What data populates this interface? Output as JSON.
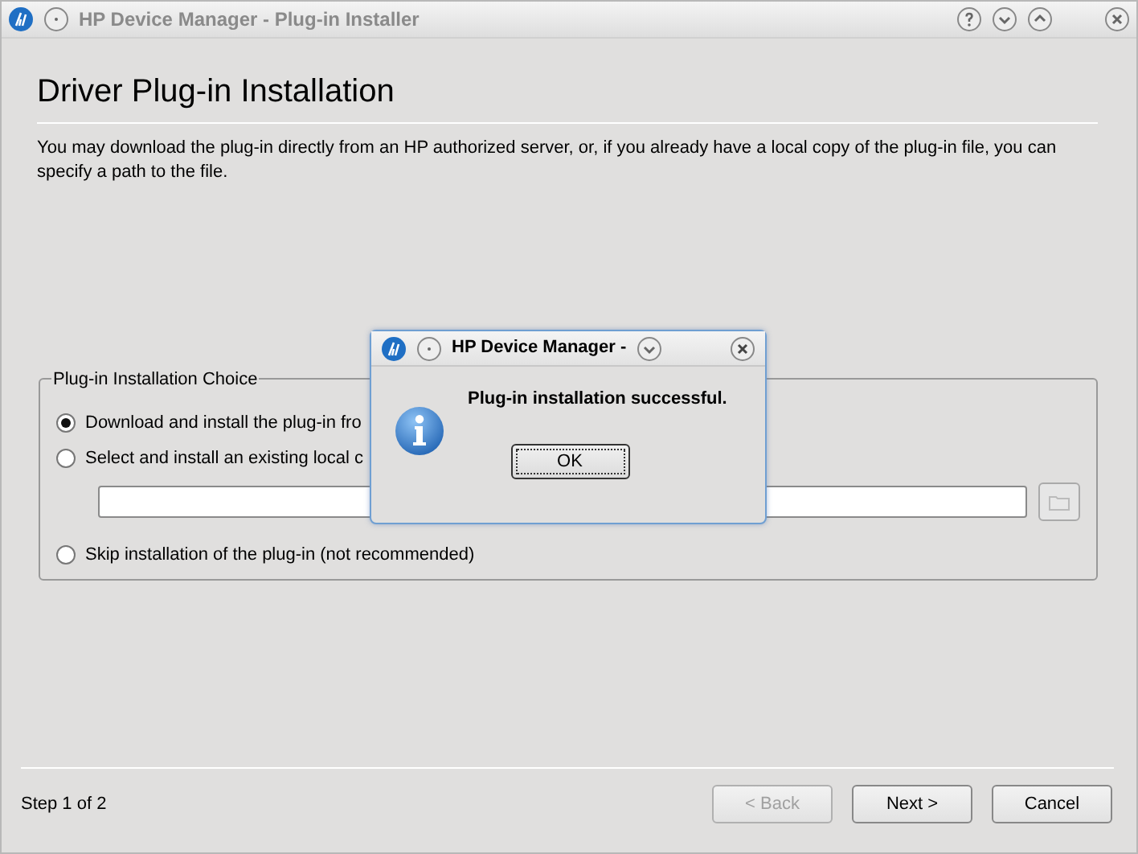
{
  "window": {
    "title": "HP Device Manager - Plug-in Installer"
  },
  "heading": "Driver Plug-in Installation",
  "description": "You may download the plug-in directly from an HP authorized server, or, if you already have a local copy of the plug-in file, you can specify a path to the file.",
  "group": {
    "title": "Plug-in Installation Choice",
    "items": [
      {
        "kind": "radio",
        "label": "Download and install the plug-in fro",
        "selected": true
      },
      {
        "kind": "radio",
        "label": "Select and install an existing local c",
        "selected": false
      },
      {
        "kind": "path",
        "browse_disabled": true
      },
      {
        "kind": "radio",
        "label": "Skip installation of the plug-in (not recommended)",
        "selected": false
      }
    ]
  },
  "footer": {
    "step": "Step 1 of 2",
    "buttons": [
      {
        "label": "< Back",
        "disabled": true
      },
      {
        "label": "Next >",
        "disabled": false
      },
      {
        "label": "Cancel",
        "disabled": false
      }
    ]
  },
  "dialog": {
    "title": "HP Device Manager -",
    "message": "Plug-in installation successful.",
    "button": "OK"
  }
}
